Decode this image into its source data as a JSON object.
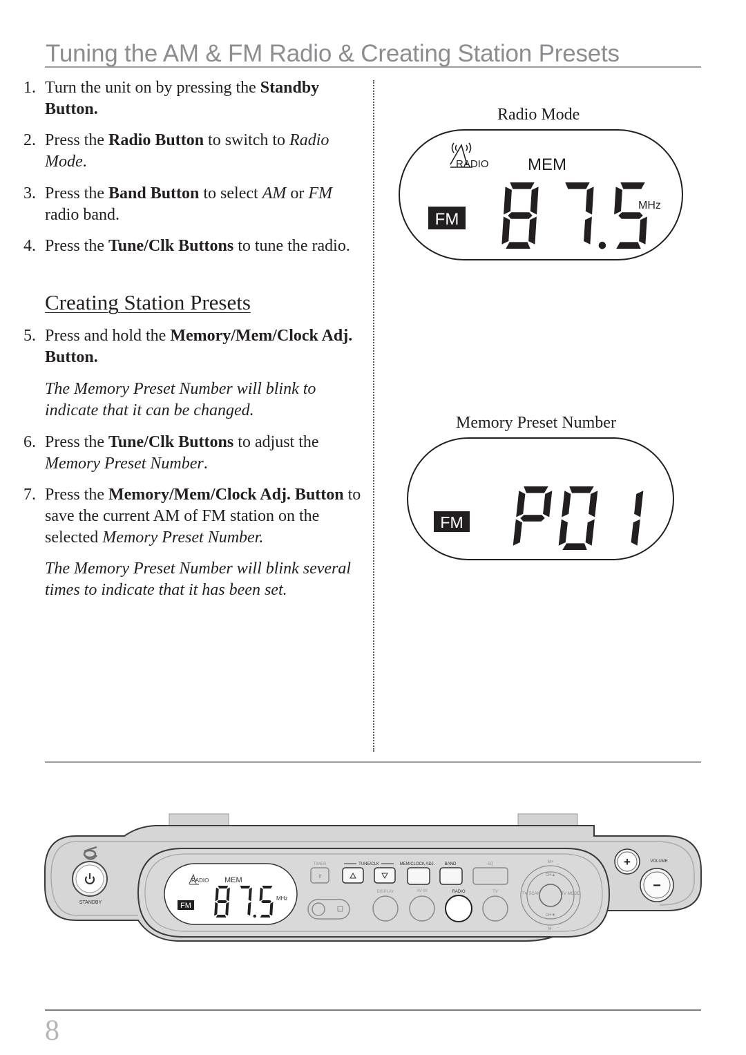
{
  "page": {
    "title": "Tuning the AM & FM Radio & Creating Station Presets",
    "page_number": "8"
  },
  "steps": [
    {
      "num": "1.",
      "parts": [
        [
          "Turn the unit on by pressing the ",
          ""
        ],
        [
          "Standby Button.",
          "b"
        ]
      ]
    },
    {
      "num": "2.",
      "parts": [
        [
          "Press the ",
          ""
        ],
        [
          "Radio Button",
          "b"
        ],
        [
          " to switch to ",
          ""
        ],
        [
          "Radio Mode",
          "i"
        ],
        [
          ".",
          ""
        ]
      ]
    },
    {
      "num": "3.",
      "parts": [
        [
          "Press the ",
          ""
        ],
        [
          "Band Button",
          "b"
        ],
        [
          " to select ",
          ""
        ],
        [
          "AM",
          "i"
        ],
        [
          " or ",
          ""
        ],
        [
          "FM",
          "i"
        ],
        [
          " radio band.",
          ""
        ]
      ]
    },
    {
      "num": "4.",
      "parts": [
        [
          "Press the ",
          ""
        ],
        [
          "Tune/Clk Buttons",
          "b"
        ],
        [
          " to tune the radio.",
          ""
        ]
      ]
    },
    {
      "num": "5.",
      "parts": [
        [
          "Press and hold the ",
          ""
        ],
        [
          "Memory/Mem/Clock Adj. Button.",
          "b"
        ]
      ]
    },
    {
      "num": "6.",
      "parts": [
        [
          "Press the ",
          ""
        ],
        [
          "Tune/Clk Buttons",
          "b"
        ],
        [
          " to adjust the ",
          ""
        ],
        [
          "Memory Preset Number",
          "i"
        ],
        [
          ".",
          ""
        ]
      ]
    },
    {
      "num": "7.",
      "parts": [
        [
          "Press the ",
          ""
        ],
        [
          "Memory/Mem/Clock Adj. Button",
          "b"
        ],
        [
          " to save the current AM of FM station on the selected ",
          ""
        ],
        [
          "Memory Preset Number.",
          "i"
        ]
      ]
    }
  ],
  "subheading": "Creating Station Presets",
  "notes": [
    "The Memory Preset Number will blink to indicate that it can be changed.",
    "The Memory Preset Number will blink several times to indicate that it has been set."
  ],
  "display1": {
    "caption": "Radio Mode",
    "radio_label": "RADIO",
    "mem_label": "MEM",
    "band": "FM",
    "frequency": "87.5",
    "unit": "MHz"
  },
  "display2": {
    "caption": "Memory Preset Number",
    "band": "FM",
    "preset": "P01"
  },
  "device": {
    "standby_label": "STANDBY",
    "lcd": {
      "radio_label": "RADIO",
      "mem_label": "MEM",
      "band": "FM",
      "frequency": "87.5",
      "unit": "MHz"
    },
    "top_labels": {
      "timer": "TIMER",
      "tune_clk": "TUNE/CLK",
      "mem_clock_adj": "MEM/CLOCK ADJ.",
      "band": "BAND",
      "eq": "EQ"
    },
    "timer_button": "T",
    "bottom_labels": {
      "display": "DISPLAY",
      "av_in": "AV IN",
      "radio": "RADIO",
      "tv": "TV"
    },
    "dpad": {
      "top": "M+",
      "up": "CH▲",
      "left": "TV SCAN",
      "right": "TV MODE",
      "down": "CH▼",
      "bottom": "M-"
    },
    "volume_label": "VOLUME",
    "vol_up": "+",
    "vol_down": "−"
  }
}
